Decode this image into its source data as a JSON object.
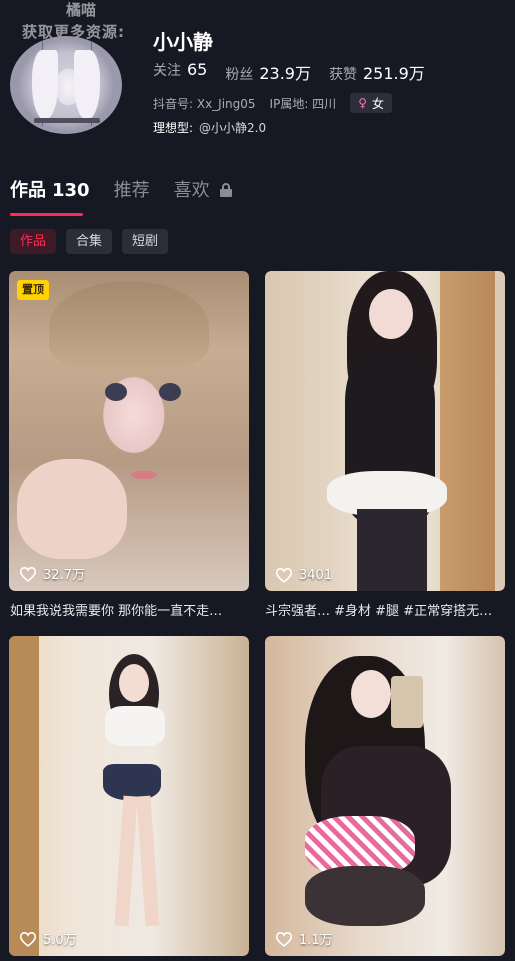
{
  "watermark": {
    "line1": "橘喵",
    "line2": "获取更多资源:"
  },
  "profile": {
    "nickname": "小小静",
    "stats": [
      {
        "label": "关注",
        "value": "65"
      },
      {
        "label": "粉丝",
        "value": "23.9万"
      },
      {
        "label": "获赞",
        "value": "251.9万"
      }
    ],
    "douyin_id": "抖音号: Xx_Jing05",
    "ip_location": "IP属地: 四川",
    "gender": "女",
    "ideal_type_label": "理想型:",
    "ideal_type_value": "@小小静2.0"
  },
  "tabs": [
    {
      "label": "作品",
      "count": "130"
    },
    {
      "label": "推荐"
    },
    {
      "label": "喜欢"
    }
  ],
  "subtabs": [
    "作品",
    "合集",
    "短剧"
  ],
  "colors": {
    "accent": "#fe2c55",
    "background": "#161823",
    "pin": "#ffd200"
  },
  "videos": [
    {
      "likes": "32.7万",
      "pinned_label": "置顶",
      "caption": "如果我说我需要你 那你能一直不走…"
    },
    {
      "likes": "3401",
      "caption": "斗宗强者… #身材 #腿 #正常穿搭无…"
    },
    {
      "likes": "5.0万",
      "caption": ""
    },
    {
      "likes": "1.1万",
      "caption": ""
    }
  ]
}
